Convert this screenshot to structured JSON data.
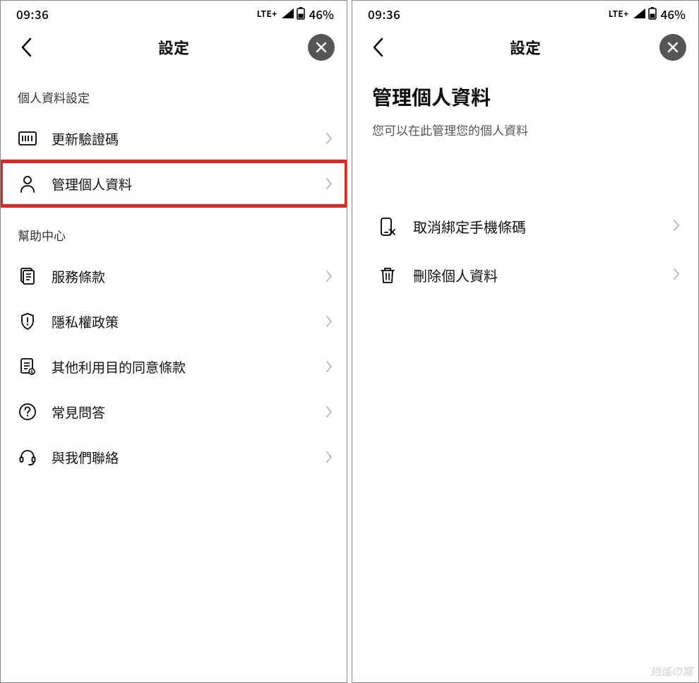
{
  "statusbar": {
    "time": "09:36",
    "lte": "LTE+",
    "battery_pct": "46%"
  },
  "left": {
    "title": "設定",
    "section1": "個人資料設定",
    "items1": [
      {
        "label": "更新驗證碼"
      },
      {
        "label": "管理個人資料"
      }
    ],
    "section2": "幫助中心",
    "items2": [
      {
        "label": "服務條款"
      },
      {
        "label": "隱私權政策"
      },
      {
        "label": "其他利用目的同意條款"
      },
      {
        "label": "常見問答"
      },
      {
        "label": "與我們聯絡"
      }
    ]
  },
  "right": {
    "title": "設定",
    "big": "管理個人資料",
    "sub": "您可以在此管理您的個人資料",
    "items": [
      {
        "label": "取消綁定手機條碼"
      },
      {
        "label": "刪除個人資料"
      }
    ]
  },
  "watermark": {
    "l1": "逍遙の窩"
  }
}
